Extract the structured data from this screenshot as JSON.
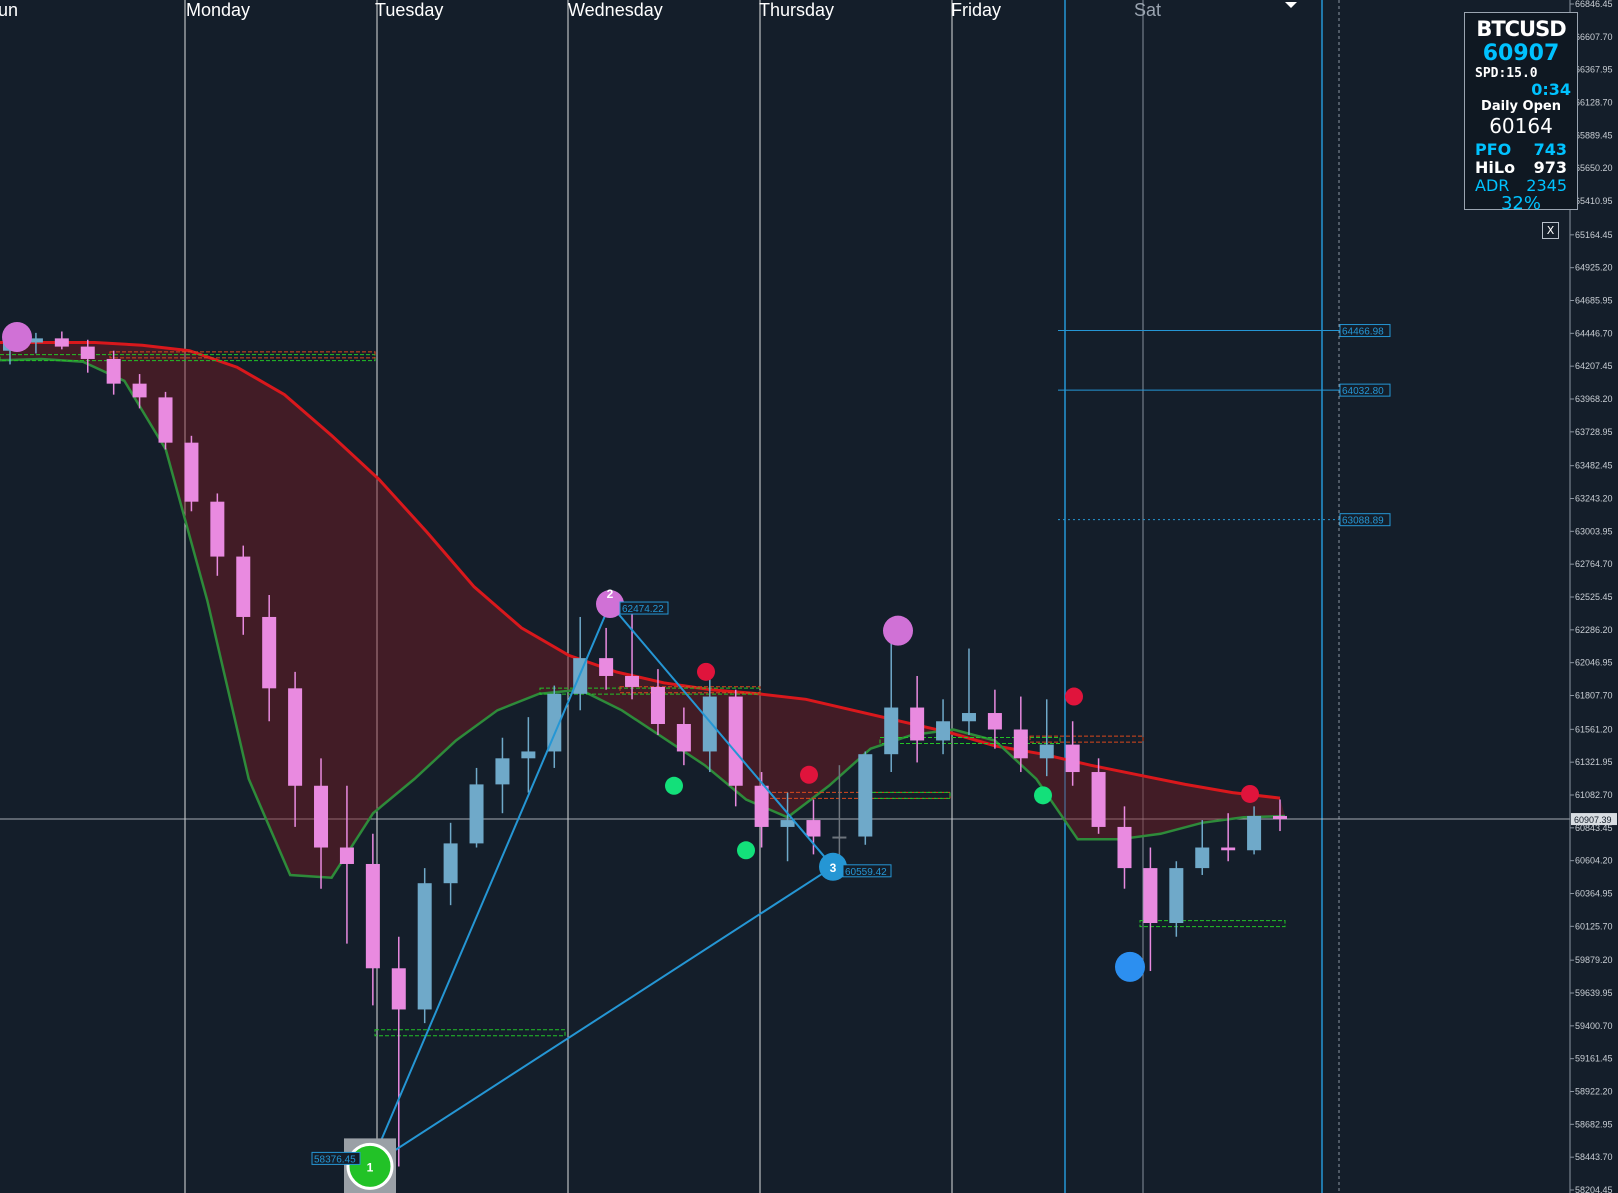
{
  "chart_data": {
    "type": "candlestick",
    "symbol": "BTCUSD",
    "y_range": [
      58204.45,
      66846.45
    ],
    "y_ticks": [
      "66846.45",
      "66607.70",
      "66367.95",
      "66128.70",
      "65889.45",
      "65650.20",
      "65410.95",
      "65164.45",
      "64925.20",
      "64685.95",
      "64446.70",
      "64207.45",
      "63968.20",
      "63728.95",
      "63482.45",
      "63243.20",
      "63003.95",
      "62764.70",
      "62525.45",
      "62286.20",
      "62046.95",
      "61807.70",
      "61561.20",
      "61321.95",
      "61082.70",
      "60843.45",
      "60604.20",
      "60364.95",
      "60125.70",
      "59879.20",
      "59639.95",
      "59400.70",
      "59161.45",
      "58922.20",
      "58682.95",
      "58443.70",
      "58204.45"
    ],
    "day_labels": [
      "Monday",
      "Tuesday",
      "Wednesday",
      "Thursday",
      "Friday",
      "Sat"
    ],
    "cut_label": "un",
    "current_price": "60907.39",
    "price_lines": [
      {
        "label": "64466.98",
        "value": 64466.98,
        "style": "solid"
      },
      {
        "label": "64032.80",
        "value": 64032.8,
        "style": "solid"
      },
      {
        "label": "63088.89",
        "value": 63088.89,
        "style": "dotted"
      }
    ],
    "zigzag": [
      {
        "label": "58376.45",
        "value": 58376.45,
        "marker": "1"
      },
      {
        "label": "62474.22",
        "value": 62474.22,
        "marker": "2"
      },
      {
        "label": "60559.42",
        "value": 60559.42,
        "marker": "3"
      }
    ],
    "slow_ma": [
      64380,
      64380,
      64380,
      64360,
      64320,
      64200,
      64000,
      63700,
      63380,
      63000,
      62600,
      62300,
      62100,
      61980,
      61900,
      61850,
      61820,
      61780,
      61700,
      61620,
      61540,
      61440,
      61380,
      61300,
      61230,
      61160,
      61100,
      61060
    ],
    "fast_ma": [
      64250,
      64260,
      64240,
      64100,
      63600,
      62500,
      61200,
      60500,
      60480,
      60950,
      61200,
      61480,
      61700,
      61820,
      61850,
      61700,
      61500,
      61300,
      61050,
      60920,
      61150,
      61420,
      61520,
      61560,
      61480,
      61200,
      60760,
      60760,
      60800,
      60880,
      60920,
      60930
    ],
    "candles": [
      [
        64320,
        64420,
        64220,
        64380
      ],
      [
        64380,
        64450,
        64300,
        64410
      ],
      [
        64410,
        64460,
        64330,
        64350
      ],
      [
        64350,
        64400,
        64160,
        64260
      ],
      [
        64260,
        64320,
        64000,
        64080
      ],
      [
        64080,
        64150,
        63900,
        63980
      ],
      [
        63980,
        64020,
        63600,
        63650
      ],
      [
        63650,
        63700,
        63150,
        63220
      ],
      [
        63220,
        63280,
        62680,
        62820
      ],
      [
        62820,
        62900,
        62250,
        62380
      ],
      [
        62380,
        62540,
        61620,
        61860
      ],
      [
        61860,
        61980,
        60850,
        61150
      ],
      [
        61150,
        61350,
        60400,
        60700
      ],
      [
        60700,
        61150,
        60000,
        60580
      ],
      [
        60580,
        60800,
        59550,
        59820
      ],
      [
        59820,
        60050,
        58376,
        59520
      ],
      [
        59520,
        60550,
        59420,
        60440
      ],
      [
        60440,
        60880,
        60280,
        60730
      ],
      [
        60730,
        61280,
        60700,
        61160
      ],
      [
        61160,
        61500,
        60950,
        61350
      ],
      [
        61350,
        61650,
        61100,
        61400
      ],
      [
        61400,
        61880,
        61280,
        61820
      ],
      [
        61820,
        62380,
        61700,
        62080
      ],
      [
        62080,
        62300,
        61850,
        61950
      ],
      [
        61950,
        62474,
        61780,
        61870
      ],
      [
        61870,
        62000,
        61520,
        61600
      ],
      [
        61600,
        61720,
        61300,
        61400
      ],
      [
        61400,
        61980,
        61250,
        61800
      ],
      [
        61800,
        61850,
        61000,
        61150
      ],
      [
        61150,
        61250,
        60700,
        60850
      ],
      [
        60850,
        61100,
        60600,
        60900
      ],
      [
        60900,
        61050,
        60650,
        60780
      ],
      [
        60780,
        61300,
        60559,
        60780
      ],
      [
        60780,
        61400,
        60720,
        61380
      ],
      [
        61380,
        62330,
        61250,
        61720
      ],
      [
        61720,
        61950,
        61320,
        61480
      ],
      [
        61480,
        61780,
        61380,
        61620
      ],
      [
        61620,
        62150,
        61520,
        61680
      ],
      [
        61680,
        61850,
        61420,
        61560
      ],
      [
        61560,
        61800,
        61250,
        61350
      ],
      [
        61350,
        61780,
        61220,
        61450
      ],
      [
        61450,
        61620,
        61150,
        61250
      ],
      [
        61250,
        61350,
        60800,
        60850
      ],
      [
        60850,
        61000,
        60400,
        60550
      ],
      [
        60550,
        60700,
        59800,
        60150
      ],
      [
        60150,
        60600,
        60050,
        60550
      ],
      [
        60550,
        60900,
        60500,
        60700
      ],
      [
        60700,
        60950,
        60600,
        60680
      ],
      [
        60680,
        61000,
        60650,
        60930
      ],
      [
        60930,
        61050,
        60820,
        60907
      ]
    ],
    "info": {
      "symbol": "BTCUSD",
      "price": "60907",
      "spd": "SPD:15.0",
      "timer": "0:34",
      "daily_open_label": "Daily Open",
      "daily_open": "60164",
      "pfo_label": "PFO",
      "pfo": "743",
      "hilo_label": "HiLo",
      "hilo": "973",
      "adr_label": "ADR",
      "adr": "2345",
      "adr_pct": "32%"
    },
    "close_button": "X",
    "colors": {
      "background": "#141e2a",
      "bull_candle": "#6fa9c9",
      "bear_candle": "#e98ae0",
      "neutral_candle": "#6e757d",
      "slow_ma": "#d9181c",
      "fast_ma": "#2e8b3a",
      "zigzag": "#2596d4",
      "support": "#22c227",
      "resistance": "#d9471c",
      "accent": "#00c2ff"
    }
  }
}
